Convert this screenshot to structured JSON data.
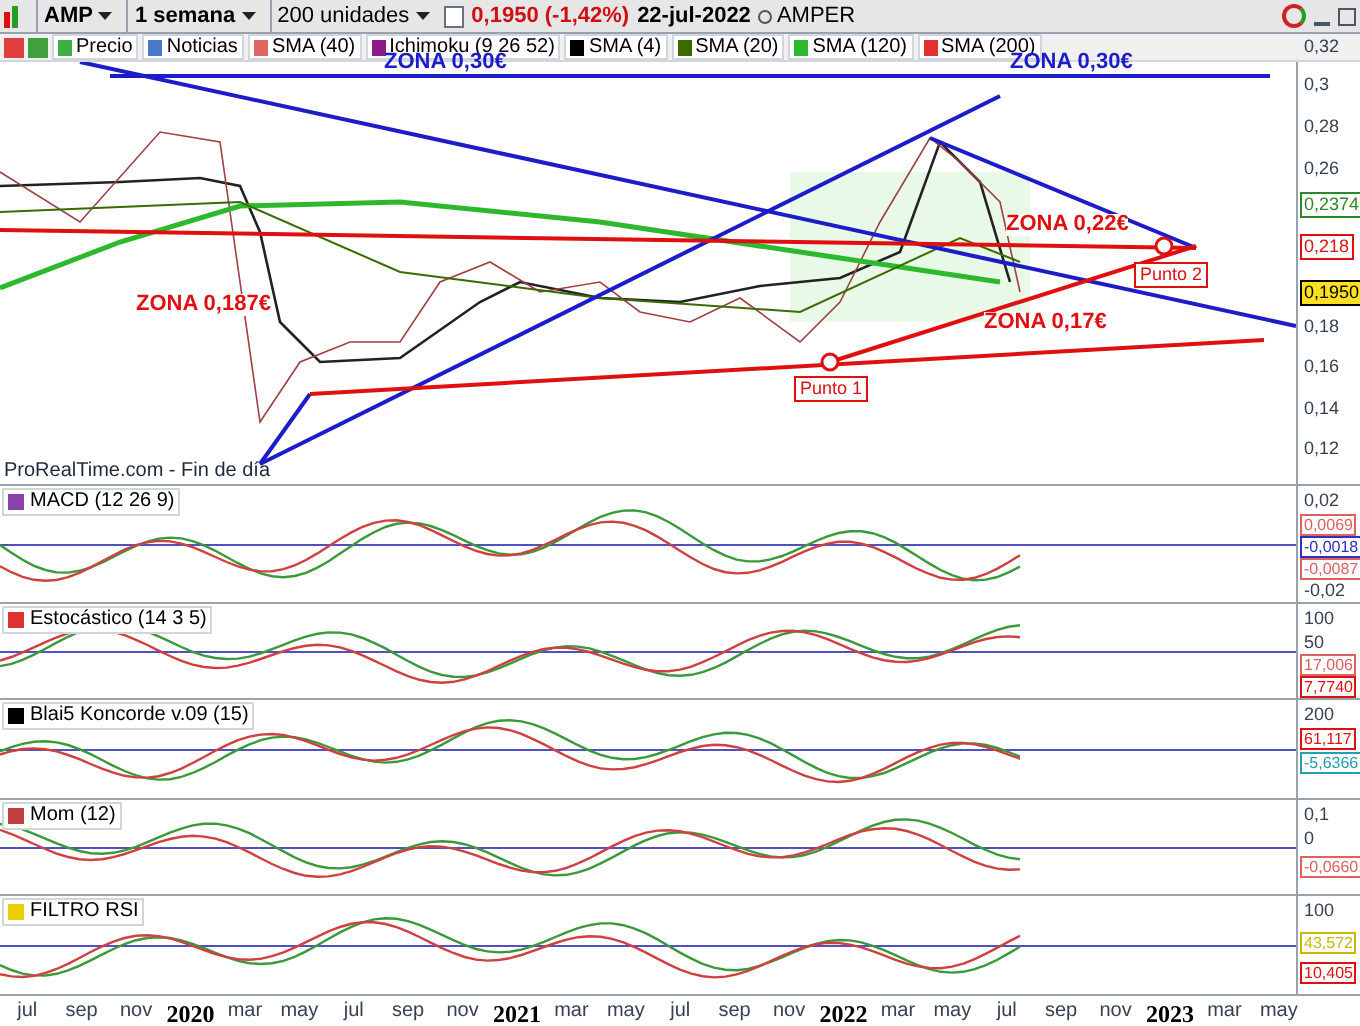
{
  "toolbar": {
    "ticker": "AMP",
    "period": "1 semana",
    "units": "200 unidades",
    "price": "0,1950 (-1,42%)",
    "date": "22-jul-2022",
    "name": "AMPER"
  },
  "legend": [
    {
      "label": "Precio",
      "color": "#3cb043"
    },
    {
      "label": "Noticias",
      "color": "#4a78c8"
    },
    {
      "label": "SMA (40)",
      "color": "#e06666"
    },
    {
      "label": "Ichimoku (9 26 52)",
      "color": "#8b1a8b"
    },
    {
      "label": "SMA (4)",
      "color": "#000000"
    },
    {
      "label": "SMA (20)",
      "color": "#3a6b00"
    },
    {
      "label": "SMA (120)",
      "color": "#2db82d"
    },
    {
      "label": "SMA (200)",
      "color": "#e03030"
    }
  ],
  "main": {
    "annotations": [
      {
        "text": "ZONA 0,30€",
        "color": "#1c1cc8"
      },
      {
        "text": "ZONA 0,30€",
        "color": "#1c1cc8"
      },
      {
        "text": "ZONA 0,22€",
        "color": "#e01010"
      },
      {
        "text": "ZONA 0,187€",
        "color": "#e01010"
      },
      {
        "text": "ZONA 0,17€",
        "color": "#e01010"
      }
    ],
    "points": [
      "Punto 1",
      "Punto 2"
    ],
    "source": "ProRealTime.com - Fin de día",
    "ticks": [
      "0,32",
      "0,3",
      "0,28",
      "0,26",
      "0,18",
      "0,16",
      "0,14",
      "0,12"
    ],
    "badges": [
      {
        "text": "0,2374",
        "color": "#2a8a2a"
      },
      {
        "text": "0,218",
        "color": "#e01010"
      },
      {
        "text": "0,1950",
        "color": "#000000"
      }
    ]
  },
  "panels": [
    {
      "title": "MACD (12 26 9)",
      "color": "#8844aa",
      "ticks": [
        "0,02",
        "-0,02"
      ],
      "badges": [
        {
          "text": "0,0069",
          "color": "#e06060"
        },
        {
          "text": "-0,0018",
          "color": "#3030c0"
        },
        {
          "text": "-0,0087",
          "color": "#e06060"
        }
      ]
    },
    {
      "title": "Estocástico (14 3 5)",
      "color": "#e03030",
      "ticks": [
        "100",
        "50"
      ],
      "badges": [
        {
          "text": "17,006",
          "color": "#e06060"
        },
        {
          "text": "7,7740",
          "color": "#e01010"
        }
      ]
    },
    {
      "title": "Blai5 Koncorde v.09 (15)",
      "color": "#000000",
      "ticks": [
        "200"
      ],
      "badges": [
        {
          "text": "61,117",
          "color": "#e01010"
        },
        {
          "text": "-5,6366",
          "color": "#20a0b0"
        }
      ]
    },
    {
      "title": "Mom (12)",
      "color": "#c04040",
      "ticks": [
        "0,1",
        "0"
      ],
      "badges": [
        {
          "text": "-0,0660",
          "color": "#e06060"
        }
      ]
    },
    {
      "title": "FILTRO RSI",
      "color": "#e8d000",
      "ticks": [
        "100"
      ],
      "badges": [
        {
          "text": "43,572",
          "color": "#c8b800"
        },
        {
          "text": "10,405",
          "color": "#e01010"
        }
      ]
    }
  ],
  "xaxis": [
    "jul",
    "sep",
    "nov",
    "2020",
    "mar",
    "may",
    "jul",
    "sep",
    "nov",
    "2021",
    "mar",
    "may",
    "jul",
    "sep",
    "nov",
    "2022",
    "mar",
    "may",
    "jul",
    "sep",
    "nov",
    "2023",
    "mar",
    "may"
  ]
}
